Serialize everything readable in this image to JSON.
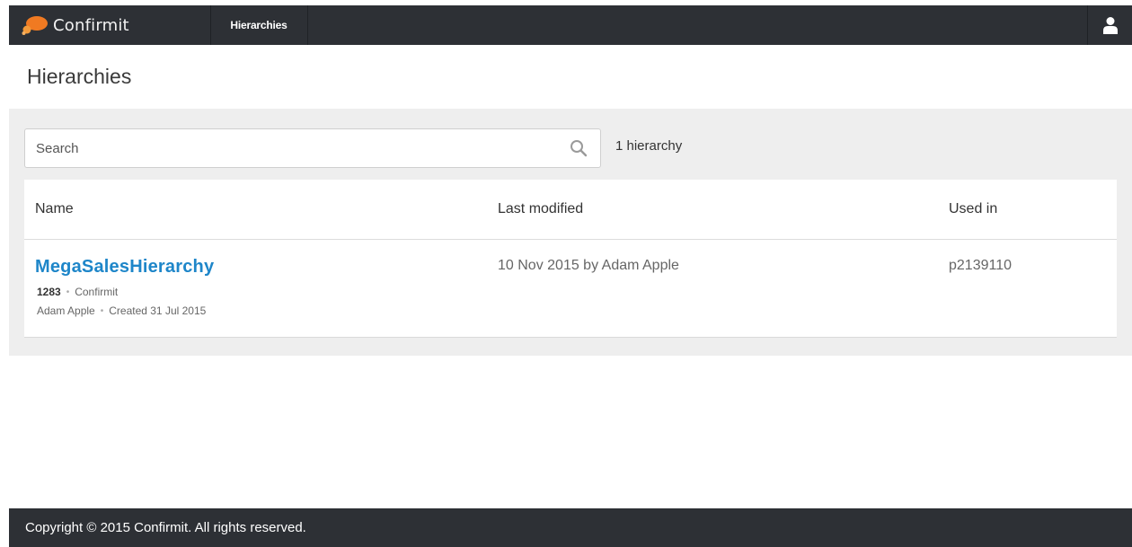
{
  "header": {
    "logo_text": "Confirmit",
    "nav_item": "Hierarchies",
    "user_icon": "user-icon",
    "brand_color": "#f07a22"
  },
  "page": {
    "title": "Hierarchies"
  },
  "search": {
    "placeholder": "Search",
    "value": "",
    "icon": "search-icon",
    "result_count": "1 hierarchy"
  },
  "table": {
    "columns": [
      "Name",
      "Last modified",
      "Used in"
    ],
    "rows": [
      {
        "name": "MegaSalesHierarchy",
        "id": "1283",
        "company": "Confirmit",
        "owner": "Adam Apple",
        "created": "Created 31 Jul 2015",
        "last_modified": "10 Nov 2015 by Adam Apple",
        "used_in": "p2139110"
      }
    ],
    "link_color": "#1e86c9"
  },
  "footer": {
    "copyright": "Copyright © 2015 Confirmit. All rights reserved."
  }
}
